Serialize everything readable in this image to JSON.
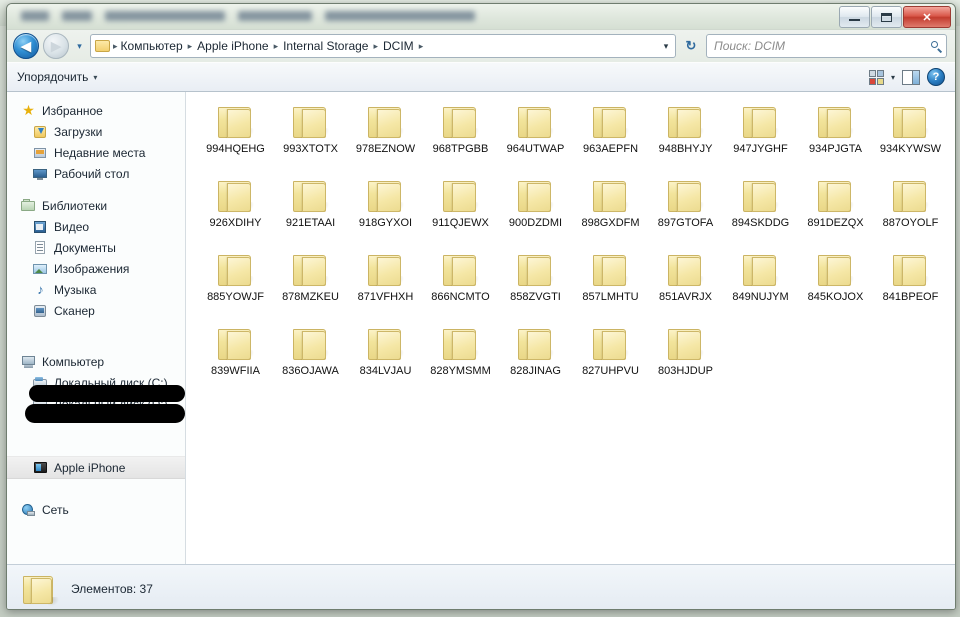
{
  "window": {
    "minimize_label": "Свернуть",
    "maximize_label": "Развернуть",
    "close_label": "✕"
  },
  "addressbar": {
    "back_label": "◀",
    "forward_label": "▶",
    "history_label": "▾",
    "crumbs": [
      "Компьютер",
      "Apple iPhone",
      "Internal Storage",
      "DCIM"
    ],
    "separator": "▸",
    "dropdown_label": "▾",
    "refresh_label": "↻"
  },
  "search": {
    "placeholder": "Поиск: DCIM"
  },
  "commandbar": {
    "organize_label": "Упорядочить",
    "organize_caret": "▾",
    "view_caret": "▾",
    "help_label": "?"
  },
  "sidebar": {
    "groups": [
      {
        "label": "Избранное",
        "icon": "star-icon",
        "items": [
          {
            "label": "Загрузки",
            "icon": "downloads-icon"
          },
          {
            "label": "Недавние места",
            "icon": "recent-places-icon"
          },
          {
            "label": "Рабочий стол",
            "icon": "desktop-icon"
          }
        ]
      },
      {
        "label": "Библиотеки",
        "icon": "libraries-icon",
        "items": [
          {
            "label": "Видео",
            "icon": "video-icon"
          },
          {
            "label": "Документы",
            "icon": "documents-icon"
          },
          {
            "label": "Изображения",
            "icon": "pictures-icon"
          },
          {
            "label": "Музыка",
            "icon": "music-icon"
          },
          {
            "label": "Сканер",
            "icon": "scanner-icon"
          }
        ]
      },
      {
        "label": "Компьютер",
        "icon": "computer-icon",
        "items": [
          {
            "label": "Локальный диск (C:)",
            "icon": "drive-icon"
          },
          {
            "label": "Локальный диск (D:)",
            "icon": "drive-icon"
          },
          {
            "label": "",
            "icon": "redacted",
            "redacted": true
          },
          {
            "label": "",
            "icon": "redacted",
            "redacted": true
          },
          {
            "label": "Apple iPhone",
            "icon": "iphone-icon",
            "selected": true
          }
        ]
      },
      {
        "label": "Сеть",
        "icon": "network-icon",
        "items": []
      }
    ]
  },
  "content": {
    "folders": [
      "994HQEHG",
      "993XTOTX",
      "978EZNOW",
      "968TPGBB",
      "964UTWAP",
      "963AEPFN",
      "948BHYJY",
      "947JYGHF",
      "934PJGTA",
      "934KYWSW",
      "926XDIHY",
      "921ETAAI",
      "918GYXOI",
      "911QJEWX",
      "900DZDMI",
      "898GXDFM",
      "897GTOFA",
      "894SKDDG",
      "891DEZQX",
      "887OYOLF",
      "885YOWJF",
      "878MZKEU",
      "871VFHXH",
      "866NCMTO",
      "858ZVGTI",
      "857LMHTU",
      "851AVRJX",
      "849NUJYM",
      "845KOJOX",
      "841BPEOF",
      "839WFIIA",
      "836OJAWA",
      "834LVJAU",
      "828YMSMM",
      "828JINAG",
      "827UHPVU",
      "803HJDUP"
    ]
  },
  "status": {
    "text": "Элементов: 37"
  },
  "colors": {
    "folder_fill": "#f5e7a6",
    "folder_border": "#cdb768",
    "chrome": "#e6ece5",
    "close_button": "#d9584a",
    "accent_blue": "#2f8fd4"
  }
}
